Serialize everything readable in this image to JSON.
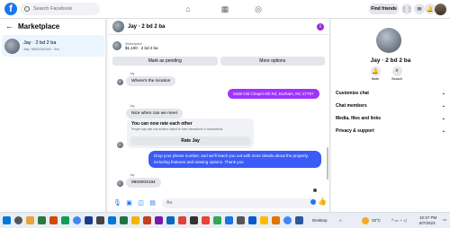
{
  "topbar": {
    "logo": "f",
    "search_placeholder": "Search Facebook",
    "find_friends": "Find friends",
    "messenger_badge": "",
    "notif_badge": "",
    "icons": [
      "home-icon",
      "marketplace-icon",
      "groups-icon",
      "menu-icon",
      "messenger-icon",
      "bell-icon"
    ]
  },
  "sidebar": {
    "title": "Marketplace",
    "conversation": {
      "name": "Jay · 2 bd 2 ba",
      "preview": "Jay: 9802004184 · 5m"
    }
  },
  "chat": {
    "header_name": "Jay · 2 bd 2 ba",
    "listing_label": "Marketplace",
    "listing_price": "$1,100 · 2 bd 2 ba",
    "mark_pending": "Mark as pending",
    "more_options": "More options",
    "messages": [
      {
        "sender": "Jay",
        "text": "Where's the location"
      },
      {
        "sender": "me",
        "text": "5639 Old Chapel Hill Rd, Durham, NC 27707"
      },
      {
        "sender": "Jay",
        "text": "Nice when can we meet"
      },
      {
        "card_title": "You can now rate each other",
        "card_sub": "People may rate one another based on their interactions or transactions.",
        "card_button": "Rate Jay"
      },
      {
        "sender": "me",
        "text": "Drop your phone number, and we'll reach you out with more details about the property, including features and viewing options.  Thank you"
      },
      {
        "sender": "Jay",
        "text": "9802004184"
      }
    ],
    "sender_label": "Jay",
    "composer_placeholder": "Aa"
  },
  "details": {
    "name": "Jay · 2 bd 2 ba",
    "mute": "Mute",
    "search": "Search",
    "items": [
      "Customize chat",
      "Chat members",
      "Media, files and links",
      "Privacy & support"
    ]
  },
  "taskbar": {
    "desktop_label": "Desktop",
    "weather": "33°C",
    "time": "10:47 PM",
    "date": "8/7/2023"
  }
}
